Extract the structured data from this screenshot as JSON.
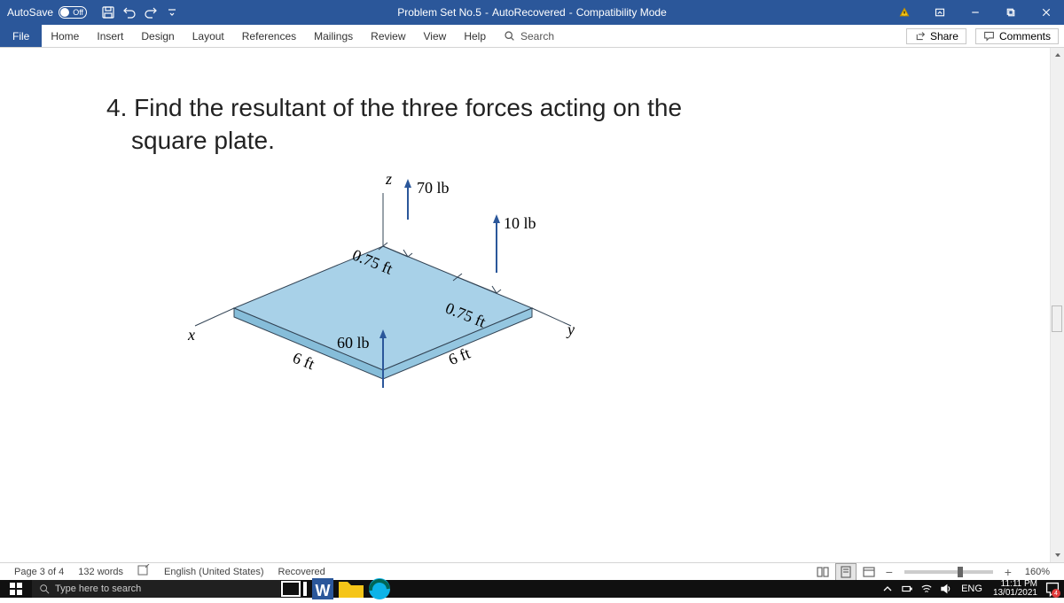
{
  "titlebar": {
    "autosave_label": "AutoSave",
    "autosave_state": "Off",
    "title_doc": "Problem Set No.5",
    "title_sep1": " - ",
    "title_recovered": "AutoRecovered",
    "title_sep2": " - ",
    "title_compat": "Compatibility Mode"
  },
  "ribbon": {
    "tabs": [
      "File",
      "Home",
      "Insert",
      "Design",
      "Layout",
      "References",
      "Mailings",
      "Review",
      "View",
      "Help"
    ],
    "search_placeholder": "Search",
    "share": "Share",
    "comments": "Comments"
  },
  "document": {
    "question_number": "4. ",
    "question_line1": "Find the resultant of the three forces acting on the",
    "question_line2": "square plate.",
    "labels": {
      "z": "z",
      "x": "x",
      "y": "y",
      "f1": "70 lb",
      "f2": "10 lb",
      "f3": "60 lb",
      "d1": "0.75 ft",
      "d2": "0.75 ft",
      "s1": "6 ft",
      "s2": "6 ft"
    }
  },
  "statusbar": {
    "page": "Page 3 of 4",
    "words": "132 words",
    "lang": "English (United States)",
    "recovered": "Recovered",
    "zoom": "160%"
  },
  "taskbar": {
    "search_placeholder": "Type here to search",
    "lang": "ENG",
    "time": "11:11 PM",
    "date": "13/01/2021",
    "notif_count": "4"
  }
}
